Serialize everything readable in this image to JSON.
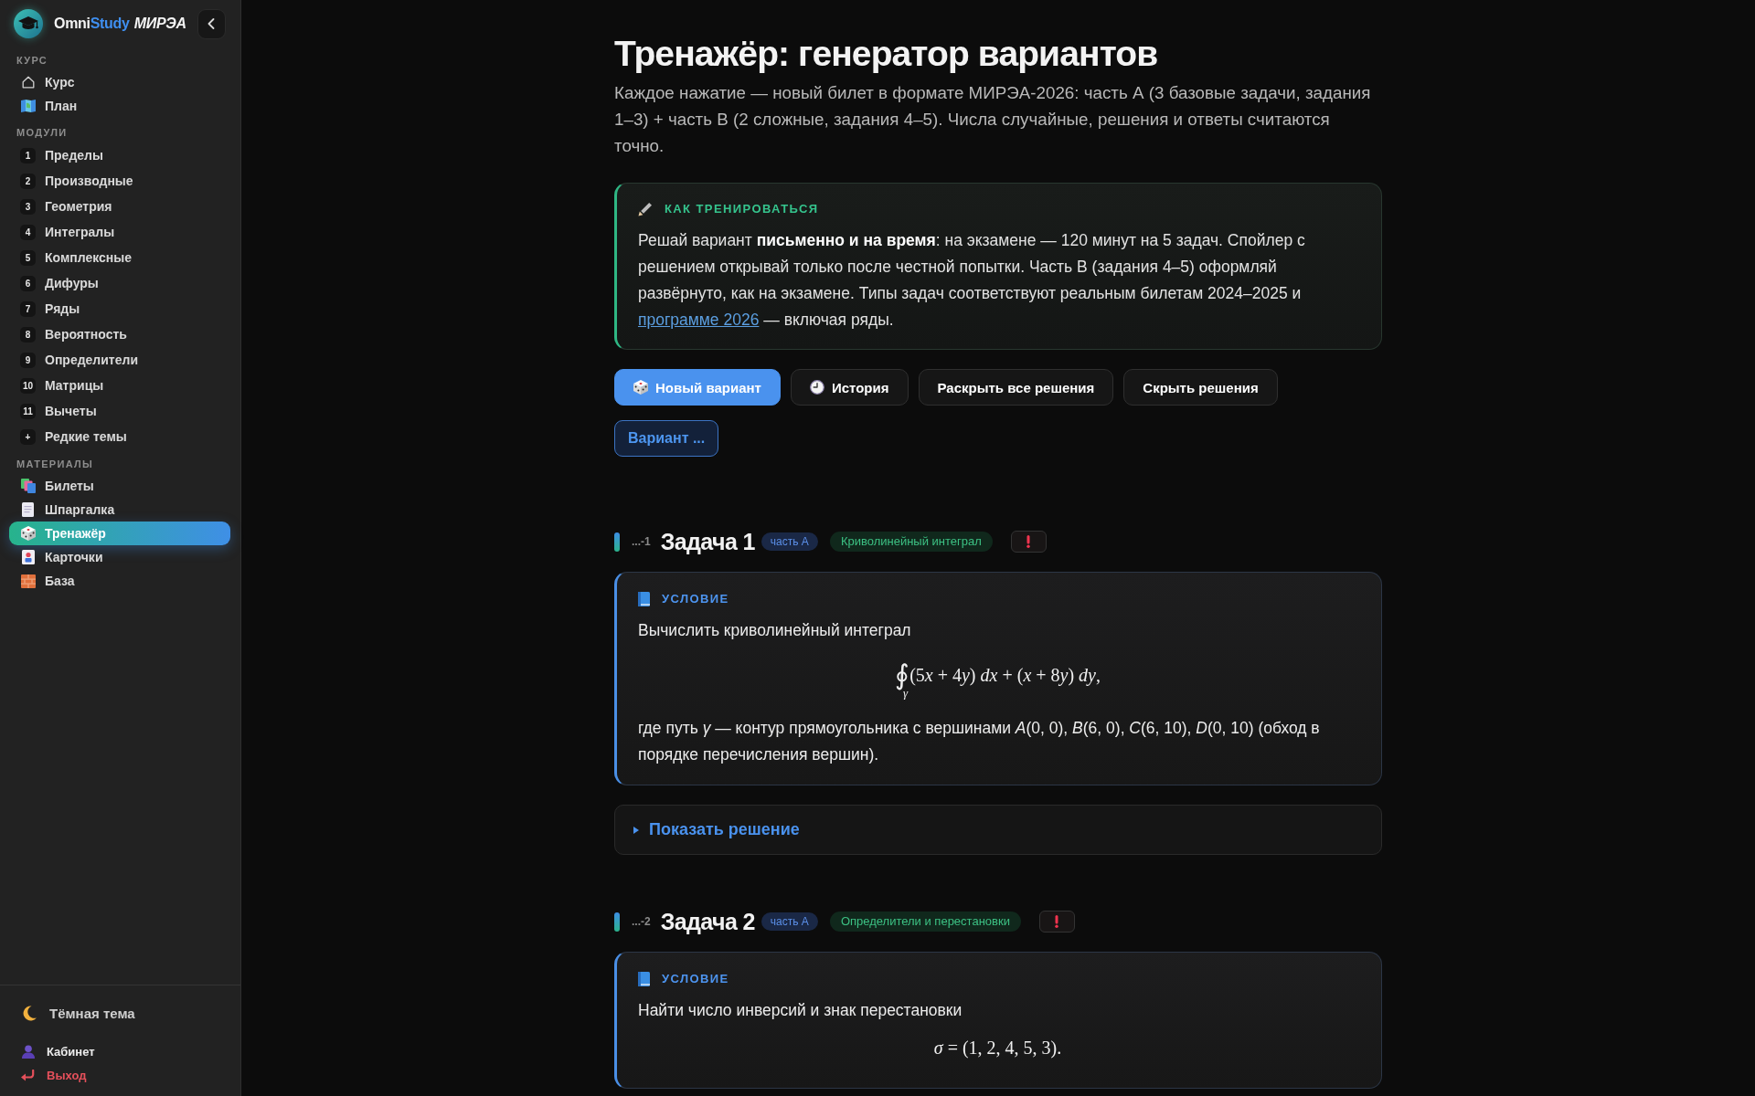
{
  "sidebar": {
    "brand": {
      "name": "Omni",
      "accent": "Study",
      "suffix": "МИРЭА"
    },
    "sections": [
      {
        "title": "КУРС",
        "items": [
          {
            "label": "Курс",
            "selected": false
          },
          {
            "label": "План",
            "selected": false
          }
        ]
      },
      {
        "title": "МОДУЛИ",
        "items": [
          {
            "number": "1",
            "label": "Пределы",
            "selected": false
          },
          {
            "number": "2",
            "label": "Производные",
            "selected": false
          },
          {
            "number": "3",
            "label": "Геометрия",
            "selected": false
          },
          {
            "number": "4",
            "label": "Интегралы",
            "selected": false
          },
          {
            "number": "5",
            "label": "Комплексные",
            "selected": false
          },
          {
            "number": "6",
            "label": "Дифуры",
            "selected": false
          },
          {
            "number": "7",
            "label": "Ряды",
            "selected": false
          },
          {
            "number": "8",
            "label": "Вероятность",
            "selected": false
          },
          {
            "number": "9",
            "label": "Определители",
            "selected": false
          },
          {
            "number": "10",
            "label": "Матрицы",
            "selected": false
          },
          {
            "number": "11",
            "label": "Вычеты",
            "selected": false
          },
          {
            "number": "+",
            "label": "Редкие темы",
            "selected": false
          }
        ]
      },
      {
        "title": "МАТЕРИАЛЫ",
        "items": [
          {
            "label": "Билеты",
            "selected": false
          },
          {
            "label": "Шпаргалка",
            "selected": false
          },
          {
            "label": "Тренажёр",
            "selected": true
          },
          {
            "label": "Карточки",
            "selected": false
          },
          {
            "label": "База",
            "selected": false
          }
        ]
      }
    ],
    "theme_toggle": {
      "label": "Тёмная тема"
    },
    "account_links": [
      {
        "kind": "profile",
        "label": "Кабинет"
      },
      {
        "kind": "logout",
        "label": "Выход"
      }
    ]
  },
  "page": {
    "title": "Тренажёр: генератор вариантов",
    "subtitle": "Каждое нажатие — новый билет в формате МИРЭА-2026: часть А (3 базовые задачи, задания 1–3) + часть В (2 сложные, задания 4–5). Числа случайные, решения и ответы считаются точно."
  },
  "tip": {
    "title": "КАК ТРЕНИРОВАТЬСЯ",
    "text": "Решай вариант **письменно и на время**: на экзамене — 120 минут на 5 задач. Спойлер с решением открывай только после честной попытки. Часть В (задания 4–5) оформляй развёрнуто, как на экзамене. Типы задач соответствуют реальным билетам 2024–2025 и",
    "link": "программе 2026",
    "text_after": "— включая ряды."
  },
  "actions": [
    {
      "kind": "primary",
      "label": "Новый вариант"
    },
    {
      "kind": "secondary",
      "label": "История"
    },
    {
      "kind": "secondary",
      "label": "Раскрыть все решения"
    },
    {
      "kind": "secondary",
      "label": "Скрыть решения"
    }
  ],
  "variant_button": {
    "label": "Вариант ..."
  },
  "tasks": [
    {
      "number": "...-1",
      "title": "Задача 1",
      "part": "часть А",
      "topic": "Криволинейный интеграл",
      "condition": {
        "label": "УСЛОВИЕ",
        "blocks": [
          {
            "kind": "text",
            "text": "Вычислить криволинейный интеграл"
          },
          {
            "kind": "formula",
            "operator": "∮",
            "operator_sub": "γ",
            "text": "(5x + 4y) dx + (x + 8y) dy,"
          },
          {
            "kind": "text",
            "text": "где путь *γ* — контур прямоугольника с вершинами *A*(0, 0), *B*(6, 0), *C*(6, 10), *D*(0, 10) (обход в порядке перечисления вершин)."
          }
        ]
      },
      "solution": {
        "label": "Показать решение",
        "expanded": false
      }
    },
    {
      "number": "...-2",
      "title": "Задача 2",
      "part": "часть А",
      "topic": "Определители и перестановки",
      "condition": {
        "label": "УСЛОВИЕ",
        "blocks": [
          {
            "kind": "text",
            "text": "Найти число инверсий и знак перестановки"
          },
          {
            "kind": "formula",
            "text": "σ = (1, 2, 4, 5, 3)."
          }
        ]
      }
    }
  ]
}
